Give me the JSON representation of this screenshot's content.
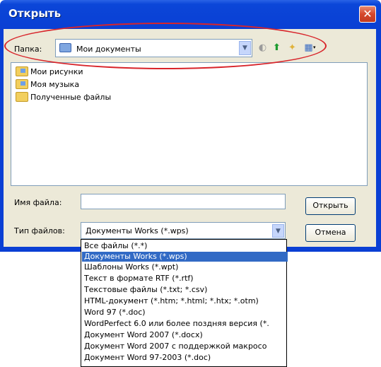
{
  "window": {
    "title": "Открыть",
    "close_glyph": "✕"
  },
  "lookin": {
    "label": "Папка:",
    "value": "Мои документы",
    "arrow": "▼"
  },
  "toolbar": {
    "back_icon": "back-icon",
    "up_icon": "up-folder-icon",
    "new_folder_icon": "new-folder-icon",
    "views_icon": "views-menu-icon",
    "back_glyph": "◐",
    "up_glyph": "⬆",
    "new_folder_glyph": "✦",
    "views_glyph": "▦",
    "views_arrow": "▾"
  },
  "files": [
    {
      "name": "Мои рисунки",
      "icon": "special-folder-icon"
    },
    {
      "name": "Моя музыка",
      "icon": "special-folder-icon"
    },
    {
      "name": "Полученные файлы",
      "icon": "folder-icon"
    }
  ],
  "filename": {
    "label": "Имя файла:",
    "value": ""
  },
  "filetype": {
    "label": "Тип файлов:",
    "value": "Документы Works (*.wps)",
    "arrow": "▼"
  },
  "buttons": {
    "open": "Открыть",
    "cancel": "Отмена"
  },
  "type_options": [
    "Все файлы (*.*)",
    "Документы Works (*.wps)",
    "Шаблоны Works (*.wpt)",
    "Текст в формате RTF (*.rtf)",
    "Текстовые файлы (*.txt; *.csv)",
    "HTML-документ (*.htm; *.html; *.htx; *.otm)",
    "Word 97 (*.doc)",
    "WordPerfect 6.0 или более поздняя версия (*.",
    "Документ Word 2007 (*.docx)",
    "Документ Word 2007 с поддержкой макросо",
    "Документ Word 97-2003 (*.doc)"
  ],
  "selected_type_index": 1,
  "colors": {
    "titlebar": "#0a3fd4",
    "selection": "#316ac5",
    "annotation": "#d8242a"
  }
}
